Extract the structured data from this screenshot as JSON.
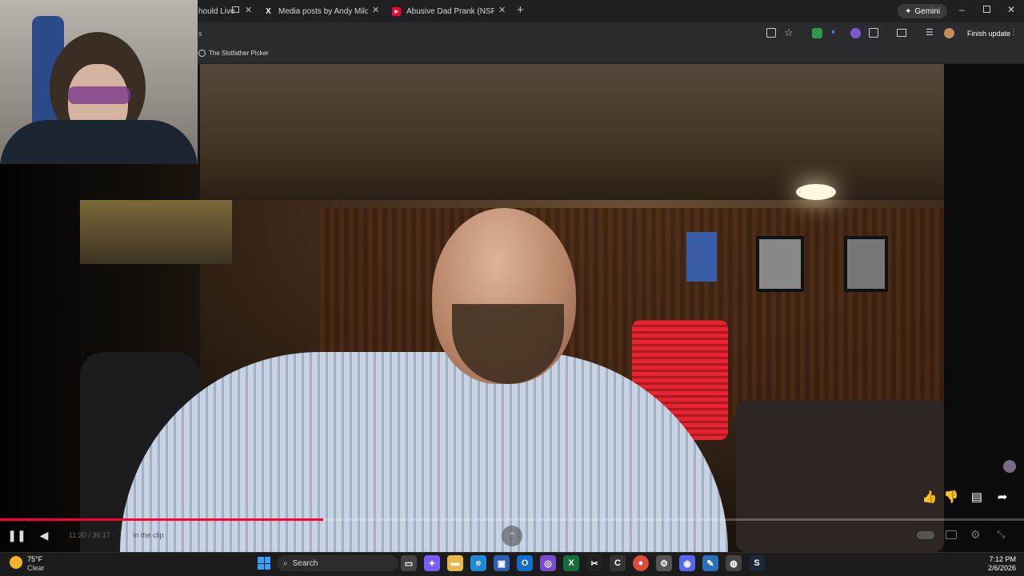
{
  "browser": {
    "tabs": [
      {
        "label": "hould Live",
        "icon": "live-icon"
      },
      {
        "label": "Media posts by Andy Milonakis",
        "icon": "x-logo-icon"
      },
      {
        "label": "Abusive Dad Prank (NSFW) - Yo",
        "icon": "youtube-icon"
      }
    ],
    "new_tab": "+",
    "gemini_label": "Gemini",
    "address_text": "s",
    "finish_update_label": "Finish update",
    "bookmark": "The Slotfather Picker"
  },
  "player": {
    "progress": 0.316,
    "time": "11:20 / 36:17",
    "chapter": "In the clip"
  },
  "taskbar": {
    "weather_temp": "75°F",
    "weather_cond": "Clear",
    "search_label": "Search",
    "time": "7:12 PM",
    "date": "2/6/2026"
  },
  "colors": {
    "accent_red": "#ff0033",
    "chrome_bg": "#2a2b2e",
    "taskbar_bg": "#1c1c1c"
  }
}
